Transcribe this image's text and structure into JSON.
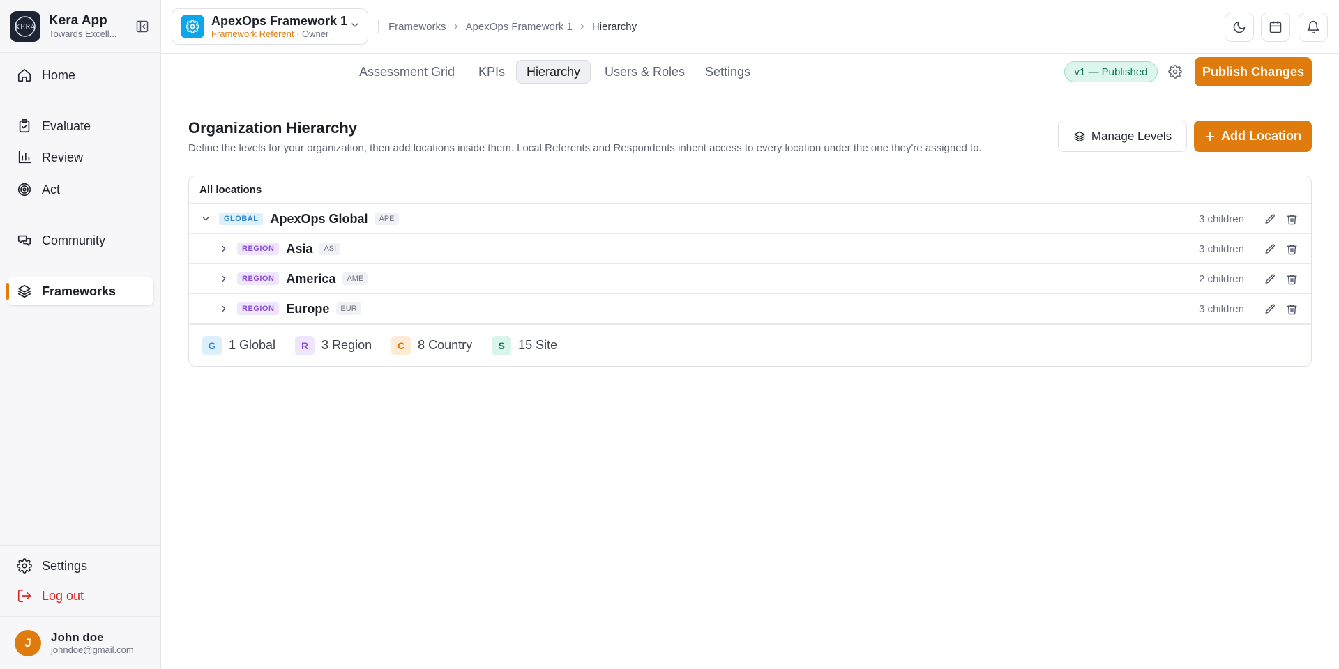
{
  "brand": {
    "name": "Kera App",
    "tagline": "Towards Excell..."
  },
  "sidebar": {
    "items": [
      {
        "label": "Home",
        "icon": "home-icon"
      },
      {
        "label": "Evaluate",
        "icon": "clipboard-check-icon"
      },
      {
        "label": "Review",
        "icon": "bar-chart-icon"
      },
      {
        "label": "Act",
        "icon": "target-icon"
      },
      {
        "label": "Community",
        "icon": "chat-bubbles-icon"
      },
      {
        "label": "Frameworks",
        "icon": "layers-icon",
        "active": true
      }
    ],
    "settings_label": "Settings",
    "logout_label": "Log out"
  },
  "user": {
    "initial": "J",
    "name": "John doe",
    "email": "johndoe@gmail.com"
  },
  "framework": {
    "name": "ApexOps Framework 1",
    "role": "Framework Referent",
    "role_sep": " · ",
    "access": "Owner"
  },
  "breadcrumb": [
    "Frameworks",
    "ApexOps Framework 1",
    "Hierarchy"
  ],
  "tabs": [
    "Assessment Grid",
    "KPIs",
    "Hierarchy",
    "Users & Roles",
    "Settings"
  ],
  "active_tab": "Hierarchy",
  "version_badge": "v1 — Published",
  "publish_label": "Publish Changes",
  "page": {
    "title": "Organization Hierarchy",
    "description": "Define the levels for your organization, then add locations inside them. Local Referents and Respondents inherit access to every location under the one they're assigned to.",
    "manage_levels_label": "Manage Levels",
    "add_location_label": "Add Location"
  },
  "panel": {
    "header": "All locations",
    "rows": [
      {
        "level": "GLOBAL",
        "name": "ApexOps Global",
        "code": "APE",
        "children": "3 children",
        "expanded": true
      },
      {
        "level": "REGION",
        "name": "Asia",
        "code": "ASI",
        "children": "3 children",
        "expanded": false
      },
      {
        "level": "REGION",
        "name": "America",
        "code": "AME",
        "children": "2 children",
        "expanded": false
      },
      {
        "level": "REGION",
        "name": "Europe",
        "code": "EUR",
        "children": "3 children",
        "expanded": false
      }
    ],
    "legend": [
      {
        "letter": "G",
        "text": "1 Global",
        "bg": "#dbeffd",
        "fg": "#2a86c9"
      },
      {
        "letter": "R",
        "text": "3 Region",
        "bg": "#efe5fd",
        "fg": "#8b4fd6"
      },
      {
        "letter": "C",
        "text": "8 Country",
        "bg": "#fdebd6",
        "fg": "#d97706"
      },
      {
        "letter": "S",
        "text": "15 Site",
        "bg": "#d9f4ea",
        "fg": "#15795c"
      }
    ]
  },
  "colors": {
    "accent": "#e07c0e",
    "framework_icon": "#0ea5e9",
    "danger": "#dc2626",
    "published": "#15795c"
  }
}
